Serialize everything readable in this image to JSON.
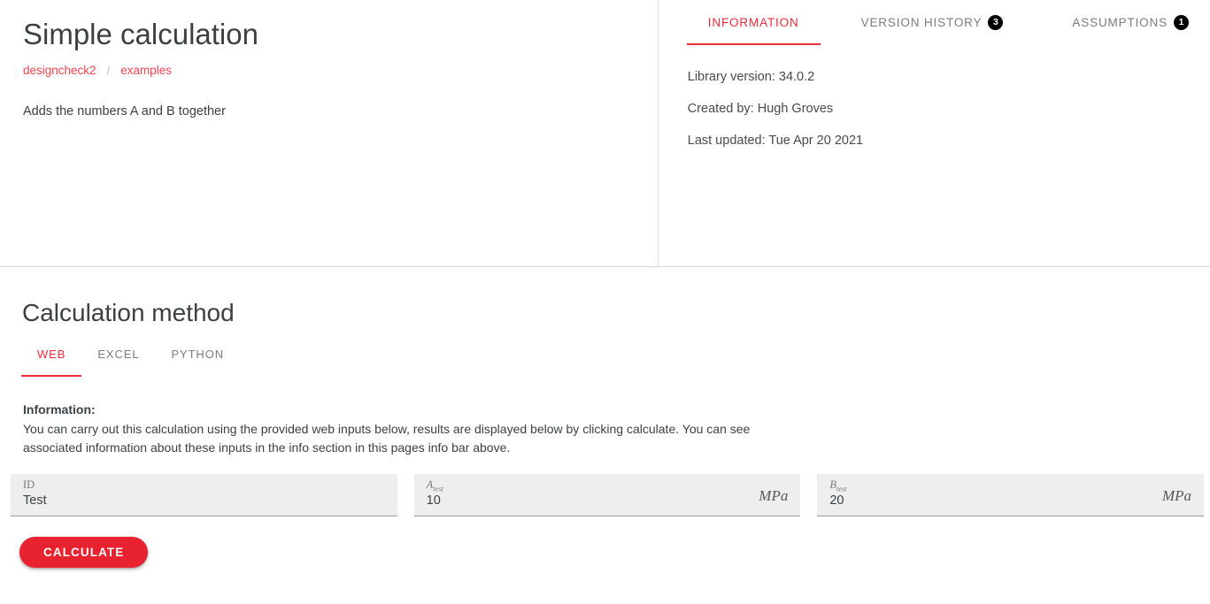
{
  "header": {
    "title": "Simple calculation",
    "breadcrumb": [
      {
        "label": "designcheck2"
      },
      {
        "label": "examples"
      }
    ],
    "breadcrumb_separator": "/",
    "description": "Adds the numbers A and B together"
  },
  "info_panel": {
    "tabs": [
      {
        "label": "INFORMATION",
        "badge": "",
        "active": true
      },
      {
        "label": "VERSION HISTORY",
        "badge": "3",
        "active": false
      },
      {
        "label": "ASSUMPTIONS",
        "badge": "1",
        "active": false
      }
    ],
    "lines": [
      "Library version: 34.0.2",
      "Created by: Hugh Groves",
      "Last updated: Tue Apr 20 2021"
    ]
  },
  "method": {
    "title": "Calculation method",
    "tabs": [
      {
        "label": "WEB",
        "active": true
      },
      {
        "label": "EXCEL",
        "active": false
      },
      {
        "label": "PYTHON",
        "active": false
      }
    ],
    "info_heading": "Information:",
    "info_paragraph": "You can carry out this calculation using the provided web inputs below, results are displayed below by clicking calculate. You can see associated information about these inputs in the info section in this pages info bar above.",
    "inputs": [
      {
        "label_base": "ID",
        "label_sub": "",
        "value": "Test",
        "unit": "",
        "upright_label": true
      },
      {
        "label_base": "A",
        "label_sub": "test",
        "value": "10",
        "unit": "MPa",
        "upright_label": false
      },
      {
        "label_base": "B",
        "label_sub": "test",
        "value": "20",
        "unit": "MPa",
        "upright_label": false
      }
    ],
    "calculate_label": "CALCULATE"
  },
  "colors": {
    "accent_red": "#ef2b38",
    "button_red": "#e8222e",
    "link_red": "#f7444e",
    "badge_black": "#000000",
    "field_background": "#eeeeee"
  }
}
